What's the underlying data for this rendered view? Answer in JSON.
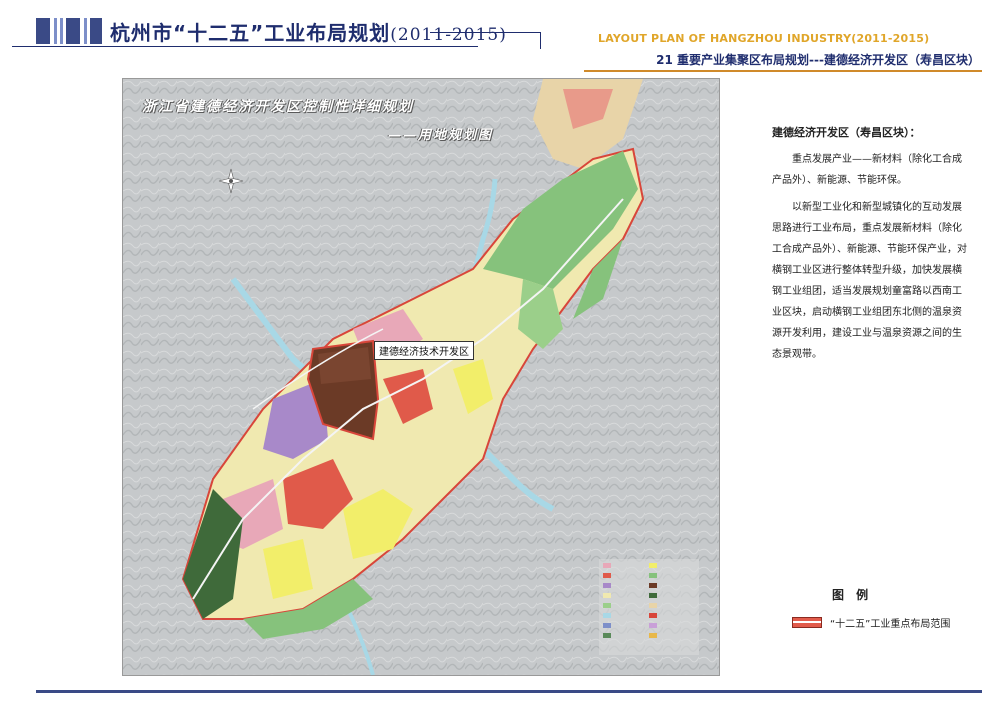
{
  "header": {
    "title_cn": "杭州市“十二五”工业布局规划",
    "title_years": "(2011-2015)",
    "title_en": "LAYOUT PLAN OF HANGZHOU INDUSTRY(2011-2015)",
    "subtitle": "21 重要产业集聚区布局规划---建德经济开发区（寿昌区块）"
  },
  "map": {
    "title_line1": "浙江省建德经济开发区控制性详细规划",
    "title_line2": "——用地规划图",
    "callout": "建德经济技术开发区",
    "colors": {
      "terrain": "#c8cbcd",
      "highlight": "#6b3a26",
      "outline": "#d8463a",
      "green": "#7fc27a",
      "yellow": "#f2ee6a",
      "purple": "#a889c9",
      "pink": "#e8a8b8",
      "red": "#e05a4a",
      "river": "#9fd8e8"
    }
  },
  "description": {
    "title": "建德经济开发区（寿昌区块）：",
    "para1": "重点发展产业——新材料（除化工合成产品外）、新能源、节能环保。",
    "para2": "以新型工业化和新型城镇化的互动发展思路进行工业布局，重点发展新材料（除化工合成产品外）、新能源、节能环保产业，对横钢工业区进行整体转型升级，加快发展横钢工业组团，适当发展规划童富路以西南工业区块，启动横钢工业组团东北侧的温泉资源开发利用，建设工业与温泉资源之间的生态景观带。"
  },
  "legend": {
    "title": "图 例",
    "item_label": "“十二五”工业重点布局范围",
    "item_color": "#e25b4b"
  }
}
